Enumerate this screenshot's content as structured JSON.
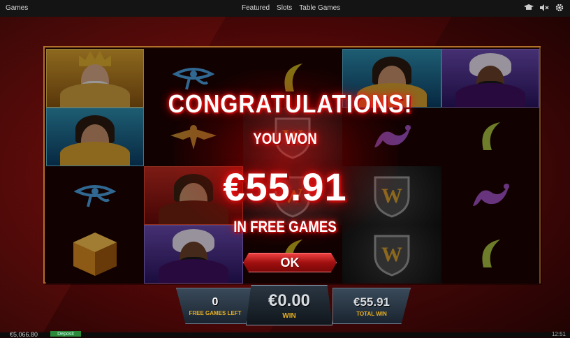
{
  "topbar": {
    "games_label": "Games",
    "nav": [
      "Featured",
      "Slots",
      "Table Games"
    ],
    "icons": [
      "graduation-cap-icon",
      "mute-icon",
      "gear-icon"
    ]
  },
  "popup": {
    "title": "CONGRATULATIONS!",
    "subtitle": "YOU WON",
    "amount": "€55.91",
    "caption": "IN FREE GAMES",
    "ok_label": "OK"
  },
  "panels": {
    "free_games_left": {
      "value": "0",
      "label": "FREE GAMES LEFT"
    },
    "win": {
      "value": "€0.00",
      "label": "WIN"
    },
    "total_win": {
      "value": "€55.91",
      "label": "TOTAL WIN"
    }
  },
  "footer": {
    "balance": "€5,066.80",
    "deposit_label": "Deposit",
    "clock": "12:51"
  },
  "colors": {
    "accent_red": "#ff2020",
    "gold": "#e8b020",
    "deposit_green": "#2a8a3a"
  }
}
